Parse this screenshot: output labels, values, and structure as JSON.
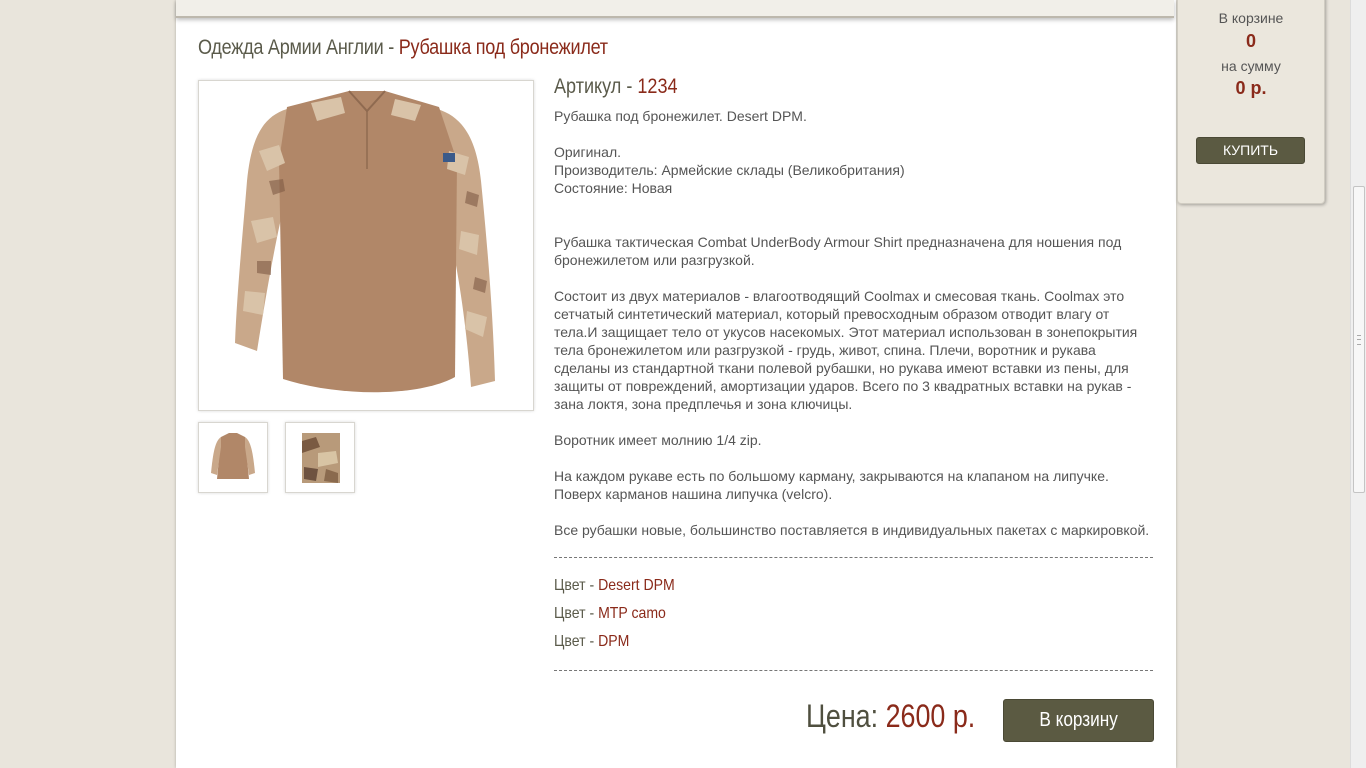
{
  "breadcrumb": {
    "category": "Одежда Армии Англии",
    "separator": " - ",
    "current": "Рубашка под бронежилет"
  },
  "product": {
    "sku_label": "Артикул",
    "sku_separator": " - ",
    "sku_value": "1234",
    "paragraphs": [
      "Рубашка под бронежилет. Desert DPM.",
      "Оригинал.",
      "Производитель: Армейские склады (Великобритания)",
      "Состояние: Новая",
      "Рубашка тактическая Combat UnderBody Armour Shirt предназначена для ношения под бронежилетом или разгрузкой.",
      "Состоит из двух материалов - влагоотводящий Coolmax и смесовая ткань. Coolmax это сетчатый синтетический материал, который превосходным образом отводит влагу от тела.И защищает тело от укусов насекомых. Этот материал использован в зонепокрытия тела бронежилетом или разгрузкой - грудь, живот, спина. Плечи, воротник и рукава сделаны из стандартной ткани полевой рубашки, но рукава имеют вставки из пены, для защиты от повреждений, амортизации ударов. Всего по 3 квадратных вставки на рукав - зана локтя, зона предплечья и зона ключицы.",
      "Воротник имеет молнию 1/4 zip.",
      "На каждом рукаве есть по большому карману, закрываются на клапаном на липучке. Поверх карманов нашина липучка (velcro).",
      "Все рубашки новые, большинство поставляется в индивидуальных пакетах с маркировкой."
    ],
    "color_label": "Цвет",
    "color_separator": " - ",
    "colors": [
      "Desert DPM",
      "MTP camo",
      "DPM"
    ],
    "price_label": "Цена: ",
    "price_value": "2600 р.",
    "add_to_cart_label": "В корзину"
  },
  "cart": {
    "in_cart_label": "В корзине",
    "count": "0",
    "sum_label": "на сумму",
    "sum": "0 р.",
    "buy_label": "КУПИТЬ"
  },
  "colors": {
    "accent": "#8a2a1a",
    "button": "#5b5a42",
    "page_bg": "#e9e5dc"
  }
}
